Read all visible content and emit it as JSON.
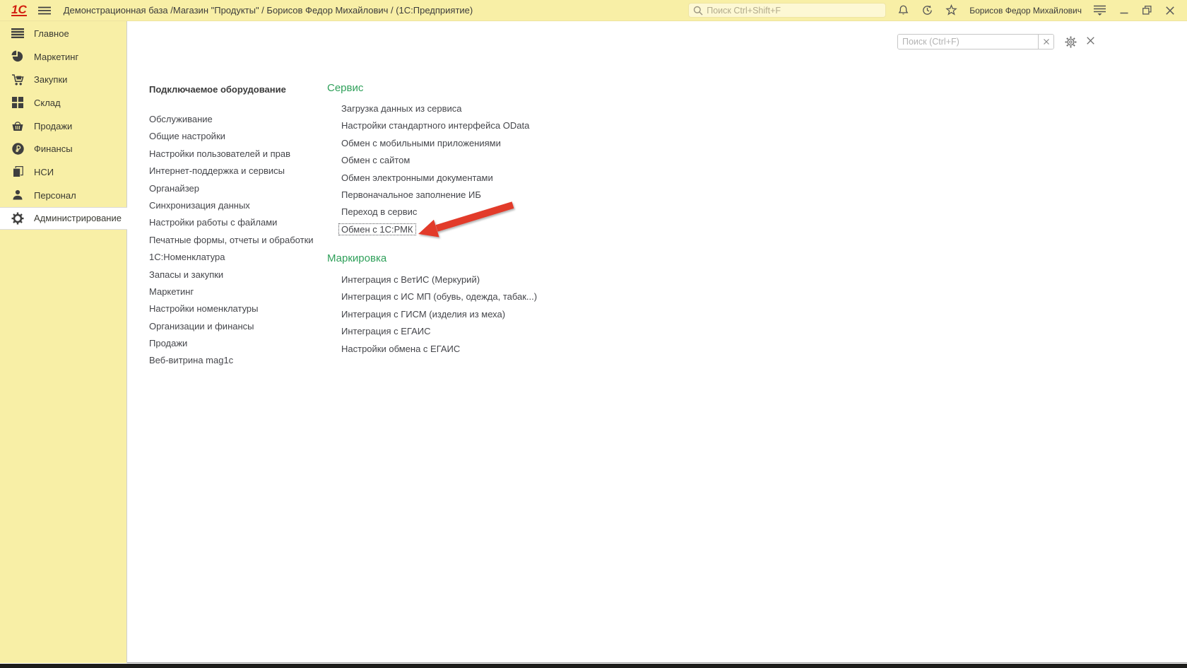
{
  "topbar": {
    "logo_text": "1С",
    "title": "Демонстрационная база /Магазин \"Продукты\" / Борисов Федор Михайлович /  (1С:Предприятие)",
    "search_placeholder": "Поиск Ctrl+Shift+F",
    "user_name": "Борисов Федор Михайлович"
  },
  "sidebar": {
    "items": [
      {
        "label": "Главное"
      },
      {
        "label": "Маркетинг"
      },
      {
        "label": "Закупки"
      },
      {
        "label": "Склад"
      },
      {
        "label": "Продажи"
      },
      {
        "label": "Финансы"
      },
      {
        "label": "НСИ"
      },
      {
        "label": "Персонал"
      },
      {
        "label": "Администрирование",
        "selected": true
      }
    ]
  },
  "content": {
    "search_placeholder": "Поиск (Ctrl+F)",
    "column1": {
      "header": "Подключаемое оборудование",
      "items": [
        "Обслуживание",
        "Общие настройки",
        "Настройки пользователей и прав",
        "Интернет-поддержка и сервисы",
        "Органайзер",
        "Синхронизация данных",
        "Настройки работы с файлами",
        "Печатные формы, отчеты и обработки",
        "1С:Номенклатура",
        "Запасы и закупки",
        "Маркетинг",
        "Настройки номенклатуры",
        "Организации и финансы",
        "Продажи",
        "Веб-витрина mag1c"
      ]
    },
    "sections": [
      {
        "header": "Сервис",
        "items": [
          "Загрузка данных из сервиса",
          "Настройки стандартного интерфейса OData",
          "Обмен с мобильными приложениями",
          "Обмен с сайтом",
          "Обмен электронными документами",
          "Первоначальное заполнение ИБ",
          "Переход в сервис",
          "Обмен с 1С:РМК"
        ],
        "focused_item": "Обмен с 1С:РМК"
      },
      {
        "header": "Маркировка",
        "items": [
          "Интеграция с ВетИС (Меркурий)",
          "Интеграция с ИС МП (обувь, одежда, табак...)",
          "Интеграция с ГИСМ (изделия из меха)",
          "Интеграция с ЕГАИС",
          "Настройки обмена с ЕГАИС"
        ]
      }
    ]
  },
  "icons": {
    "logo": "1С stripes",
    "menu": "hamburger",
    "search": "magnifier",
    "notifications": "bell",
    "history": "clock-arrow",
    "favorites": "star",
    "user-menu": "hamburger-caret",
    "minimize": "–",
    "restore": "overlapping-squares",
    "close": "×",
    "clear": "×",
    "settings": "gear",
    "pointer": "red-arrow"
  },
  "colors": {
    "panel_yellow": "#f8efa6",
    "accent_green": "#2fa05a",
    "arrow_red": "#e23a2b",
    "logo_red": "#d21e0f"
  }
}
